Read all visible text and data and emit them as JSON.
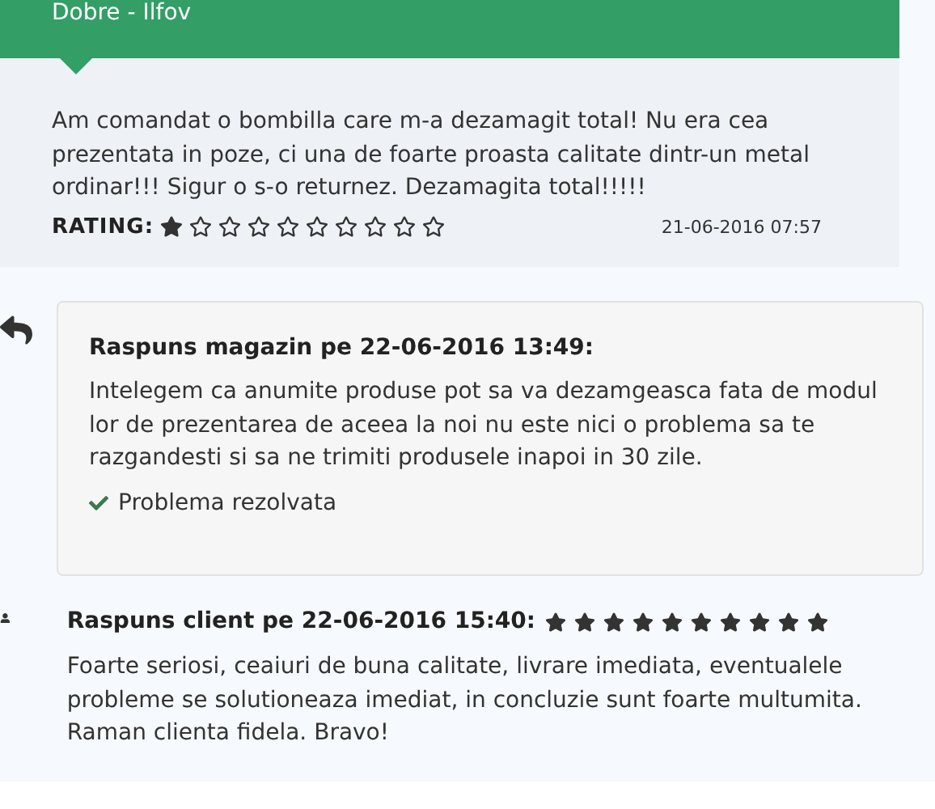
{
  "review": {
    "author": "Dobre - Ilfov",
    "text": "Am comandat o bombilla care m-a dezamagit total! Nu era cea prezentata in poze, ci una de foarte proasta calitate dintr-un metal ordinar!!! Sigur o s-o returnez. Dezamagita total!!!!!",
    "rating_label": "RATING:",
    "stars": 1,
    "date": "21-06-2016 07:57"
  },
  "shop_reply": {
    "title": "Raspuns magazin pe 22-06-2016 13:49:",
    "text": "Intelegem ca anumite produse pot sa va dezamgeasca fata de modul lor de prezentarea de aceea la noi nu este nici o problema sa te razgandesti si sa ne trimiti produsele inapoi in 30 zile.",
    "resolved": true,
    "resolved_label": "Problema rezolvata"
  },
  "client_reply": {
    "title": "Raspuns client pe 22-06-2016 15:40:",
    "stars": 10,
    "text": "Foarte seriosi, ceaiuri de buna calitate, livrare imediata, eventualele probleme se solutioneaza imediat, in concluzie sunt foarte multumita. Raman clienta fidela. Bravo!"
  }
}
